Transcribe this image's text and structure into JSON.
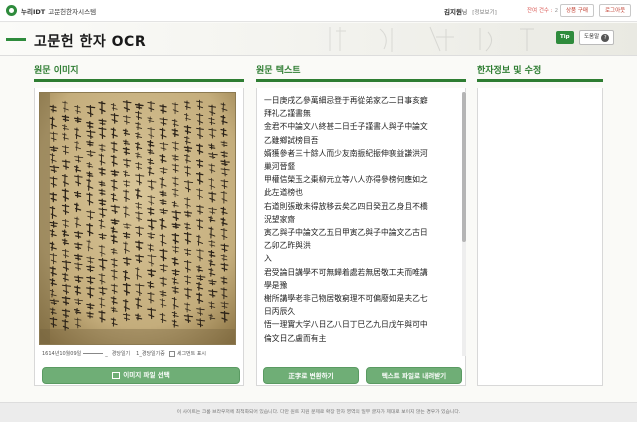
{
  "topbar": {
    "brand": "누리IDT",
    "system_name": "고문헌한자시스템",
    "user_name": "김지원",
    "user_suffix": "님",
    "user_link": "[정보보기]",
    "view_label": "잔여 건수 :",
    "view_count": "2",
    "buy_label": "상품 구매",
    "logout_label": "로그아웃"
  },
  "title": {
    "text": "고문헌 한자 OCR",
    "tip_label": "Tip",
    "help_label": "도움말"
  },
  "columns": {
    "image": {
      "heading": "원문 이미지"
    },
    "text": {
      "heading": "원문 텍스트"
    },
    "info": {
      "heading": "한자정보 및 수정"
    }
  },
  "image_panel": {
    "caption_date": "1614년10월09일",
    "caption_sep1": "_",
    "caption_b": "경당일기",
    "caption_c": "1_경당일기증",
    "caption_chk": "세그먼트 표시",
    "select_button": "이미지 파일 선택"
  },
  "ocr_lines": [
    "一日庚戌乙參萬細忌登于再從弟家乙二日事亥癖",
    "拜礼乙謹書無",
    "金君不中論文八終甚二日壬子謹書人與子中論文",
    "乙雖鄉試榜目吾",
    "婿獲參者三十餘人而少友南振紀振伸裵益謙洪河",
    "巢河晉韰",
    "甲權信榮玉之棗柳元立等八人亦得參榜何應如之",
    "此左道榜也",
    "右道則張敢未得放移云矣乙四日癸丑乙身且不橋",
    "況望家齋",
    "寅乙與子中論文乙五日甲寅乙與子中論文乙古日",
    "乙卯乙昨與洪",
    "入",
    "君受論日講學不可無歸着處若無居敬工夫而唯講",
    "學是豫",
    "榭所講學老非己物居敬窮理不可偏廢如是夫乙七",
    "日丙辰久",
    "悟一理實大学八日乙八日丁巳乙九日戊午與可中",
    "倫文日乙盧而有主"
  ],
  "text_panel": {
    "convert_button": "正字로 변환하기",
    "download_button": "텍스트 파일로 내려받기"
  },
  "footer": {
    "text": "이 사이트는 크롬 브라우저에 최적화되어 있습니다. 다만 원트 지원 문제로 확장 한자 영역의 일부 글자가 제대로 보이지 않는 경우가 있습니다."
  },
  "colors": {
    "accent": "#2e7d32",
    "button": "#6fae76",
    "alert": "#d9534f"
  }
}
